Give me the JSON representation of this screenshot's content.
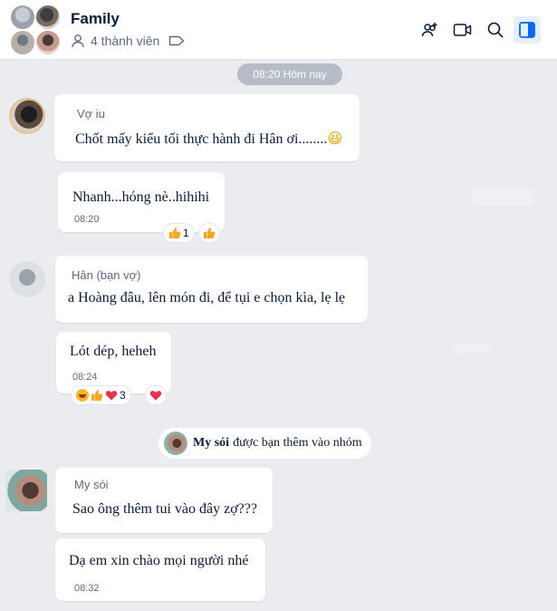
{
  "header": {
    "title": "Family",
    "members_label": "4 thành viên"
  },
  "date_divider": "08:20 Hôm nay",
  "messages": [
    {
      "sender": "Vợ iu",
      "text": "Chốt mấy kiểu tối thực hành đi Hân ơi........",
      "emoji": "😆"
    },
    {
      "text": "Nhanh...hóng nè..hihihi",
      "time": "08:20",
      "reaction_count": "1"
    },
    {
      "sender": "Hân (bạn vợ)",
      "text": "a Hoàng đâu, lên món đi, để tụi e chọn kìa, lẹ lẹ"
    },
    {
      "text": "Lót dép, heheh",
      "time": "08:24",
      "reaction_count": "3"
    },
    {
      "sender": "My sói",
      "text": "Sao ông thêm tui vào đây zợ???"
    },
    {
      "text": "Dạ em xin chào mọi người nhé",
      "time": "08:32"
    }
  ],
  "notice": {
    "name": "My sói",
    "text": "được bạn thêm vào nhóm"
  },
  "icons": [
    "user-icon",
    "tag-icon",
    "add-member-icon",
    "video-call-icon",
    "search-icon",
    "sidebar-toggle-icon",
    "like-icon",
    "heart-icon",
    "laugh-icon"
  ],
  "colors": {
    "accent": "#0068ff",
    "heart": "#e8324a",
    "like": "#f5a623"
  }
}
